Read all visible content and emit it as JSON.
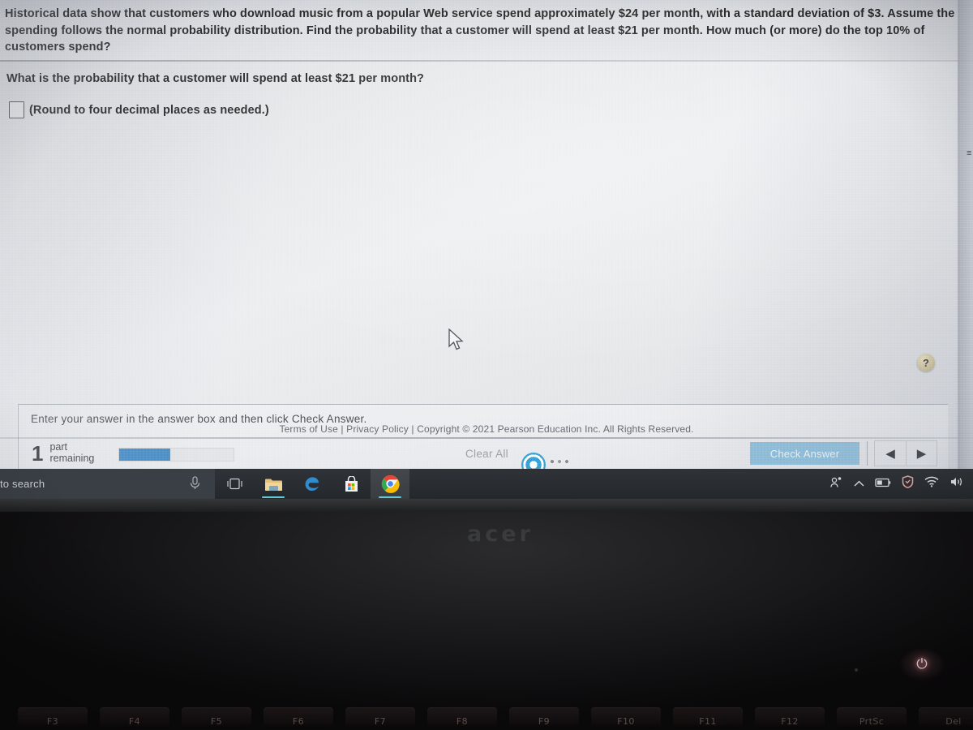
{
  "question": {
    "prompt": "Historical data show that customers who download music from a popular Web service spend approximately $24 per month, with a standard deviation of $3. Assume the spending follows the normal probability distribution. Find the probability that a customer will spend at least $21 per month. How much (or more) do the top 10% of customers spend?",
    "sub_question": "What is the probability that a customer will spend at least $21 per month?",
    "answer_value": "",
    "rounding_note": "(Round to four decimal places as needed.)"
  },
  "action_bar": {
    "enter_hint": "Enter your answer in the answer box and then click Check Answer.",
    "parts_number": "1",
    "parts_label_line1": "part",
    "parts_label_line2": "remaining",
    "progress_percent": 45,
    "clear_all_label": "Clear All",
    "check_answer_label": "Check Answer",
    "prev_label": "◀",
    "next_label": "▶",
    "help_label": "?"
  },
  "footer": {
    "text": "Terms of Use | Privacy Policy | Copyright © 2021 Pearson Education Inc. All Rights Reserved."
  },
  "right_edge": {
    "mark": "≡"
  },
  "taskbar": {
    "search_placeholder": "to search",
    "icons": [
      {
        "name": "cortana-microphone-icon",
        "glyph": "⭔"
      },
      {
        "name": "task-view-icon",
        "glyph": "❑"
      },
      {
        "name": "file-explorer-icon",
        "glyph": "🗀"
      },
      {
        "name": "edge-browser-icon",
        "glyph": "e"
      },
      {
        "name": "microsoft-store-icon",
        "glyph": "⊞"
      },
      {
        "name": "chrome-browser-icon",
        "glyph": "◎"
      }
    ],
    "tray": [
      {
        "name": "people-icon",
        "glyph": "ʀ"
      },
      {
        "name": "show-hidden-icons-chevron",
        "glyph": "∧"
      },
      {
        "name": "battery-icon",
        "glyph": "▭"
      },
      {
        "name": "security-shield-icon",
        "glyph": "⛉"
      },
      {
        "name": "wifi-icon",
        "glyph": "◠"
      },
      {
        "name": "volume-icon",
        "glyph": "♦"
      }
    ]
  },
  "laptop": {
    "brand": "acer",
    "power_glyph": "⏻",
    "function_keys": [
      "F3",
      "F4",
      "F5",
      "F6",
      "F7",
      "F8",
      "F9",
      "F10",
      "F11",
      "F12",
      "PrtSc",
      "Del"
    ]
  },
  "colors": {
    "progress_fill": "#4a8fc8",
    "check_button": "#8fc0dc",
    "taskbar": "#2a2e33",
    "help_button": "#cdbf92"
  }
}
